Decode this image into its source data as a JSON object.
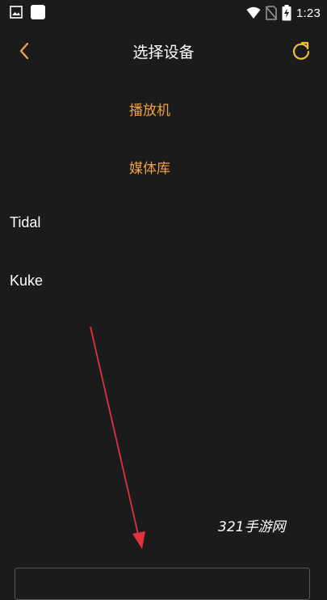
{
  "status_bar": {
    "time": "1:23",
    "icons": [
      "gallery-icon",
      "app-square-icon",
      "wifi-icon",
      "no-sim-icon",
      "battery-charging-icon"
    ]
  },
  "header": {
    "title": "选择设备",
    "back_icon": "chevron-left-icon",
    "refresh_icon": "refresh-icon"
  },
  "device_list": {
    "items": [
      {
        "label": "播放机"
      },
      {
        "label": "媒体库"
      },
      {
        "label": "Tidal"
      },
      {
        "label": "Kuke"
      }
    ]
  },
  "watermark": {
    "text": "321手游网"
  },
  "colors": {
    "background": "#1b1b1b",
    "accent": "#f0a044",
    "annotation_arrow": "#e0313c"
  }
}
